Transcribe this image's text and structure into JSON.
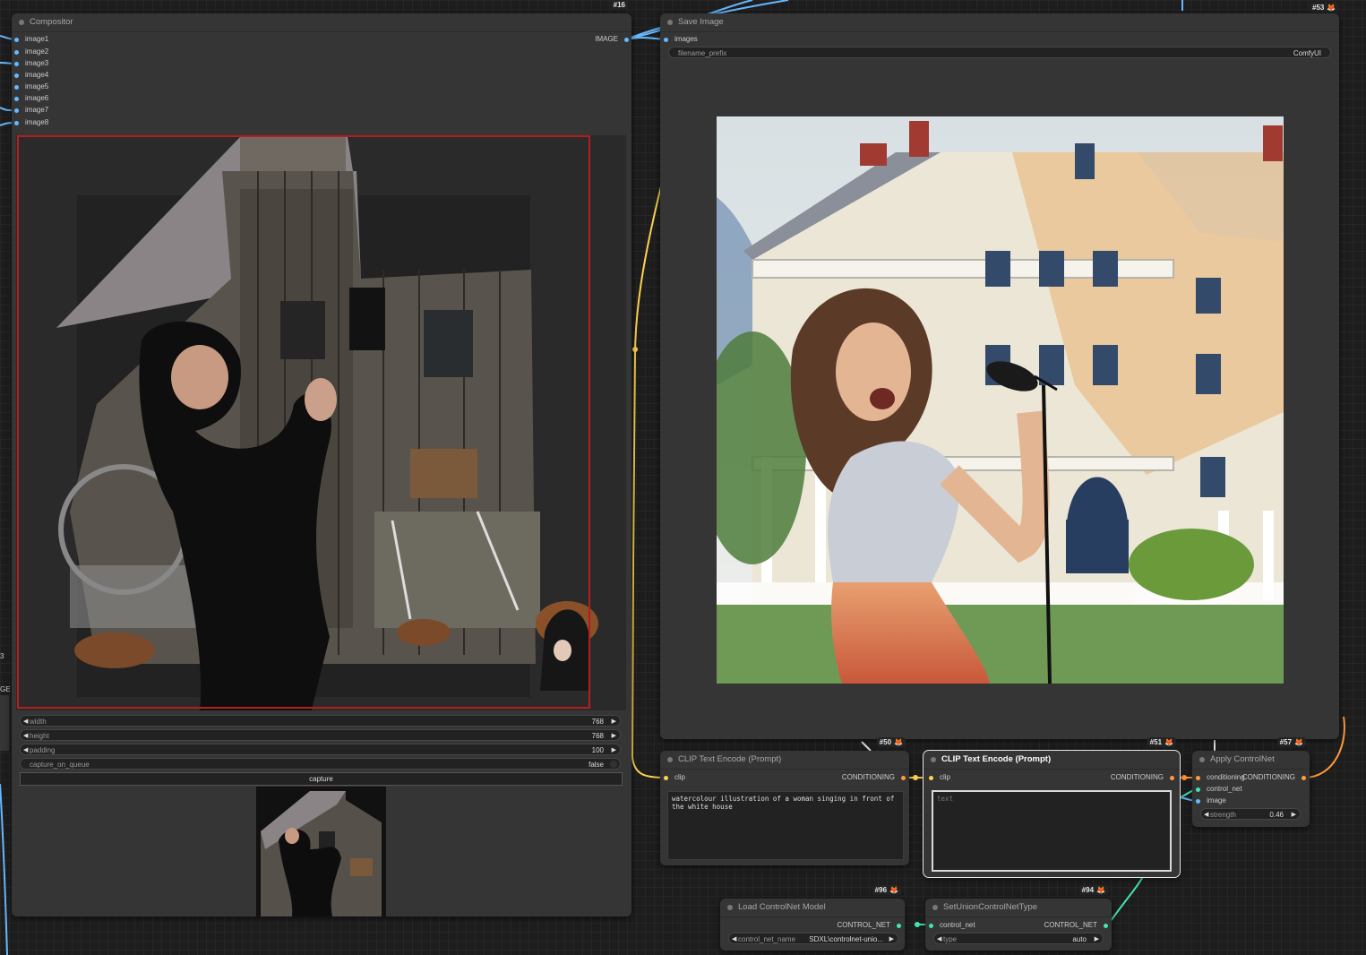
{
  "nodes": {
    "compositor": {
      "title": "Compositor",
      "badge": "#16",
      "inputs": [
        "image1",
        "image2",
        "image3",
        "image4",
        "image5",
        "image6",
        "image7",
        "image8"
      ],
      "output": "IMAGE",
      "widgets": {
        "width": {
          "label": "width",
          "value": "768"
        },
        "height": {
          "label": "height",
          "value": "768"
        },
        "padding": {
          "label": "padding",
          "value": "100"
        },
        "capture_on_queue": {
          "label": "capture_on_queue",
          "value": "false"
        }
      },
      "capture_button": "capture"
    },
    "save_image": {
      "title": "Save Image",
      "input": "images",
      "filename_prefix": {
        "label": "filename_prefix",
        "value": "ComfyUI"
      }
    },
    "clip50": {
      "title": "CLIP Text Encode (Prompt)",
      "badge": "#50",
      "input": "clip",
      "output": "CONDITIONING",
      "text": "watercolour illustration of a woman singing in front of the white house"
    },
    "clip51": {
      "title": "CLIP Text Encode (Prompt)",
      "badge": "#51",
      "input": "clip",
      "output": "CONDITIONING",
      "placeholder": "text"
    },
    "apply_controlnet": {
      "title": "Apply ControlNet",
      "badge": "#57",
      "inputs": [
        "conditioning",
        "control_net",
        "image"
      ],
      "output": "CONDITIONING",
      "strength": {
        "label": "strength",
        "value": "0.46"
      }
    },
    "load_controlnet": {
      "title": "Load ControlNet Model",
      "badge": "#96",
      "output": "CONTROL_NET",
      "control_net_name": {
        "label": "control_net_name",
        "value": "SDXL\\controlnet-unio..."
      }
    },
    "set_union": {
      "title": "SetUnionControlNetType",
      "badge": "#94",
      "input": "control_net",
      "output": "CONTROL_NET",
      "type": {
        "label": "type",
        "value": "auto"
      }
    }
  },
  "offscreen": {
    "badge_53": "#53",
    "left_badge": "3",
    "left_label": "GE"
  },
  "colors": {
    "image_link": "#67b8ff",
    "clip_link": "#ffd34d",
    "conditioning_link": "#ff9b3d",
    "controlnet_link": "#41e6b5"
  }
}
